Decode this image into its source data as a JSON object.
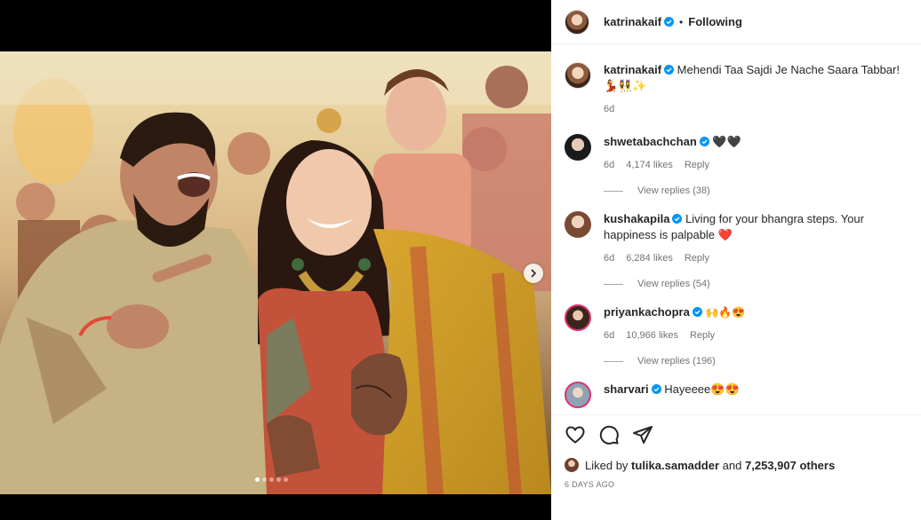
{
  "post": {
    "author": "katrinakaif",
    "follow_status": "Following",
    "separator": "•",
    "caption": "Mehendi Taa Sajdi Je Nache Saara Tabbar! 💃👯‍♀️✨",
    "caption_age": "6d",
    "media": {
      "slide_count": 5,
      "active_slide": 1
    }
  },
  "comments": [
    {
      "username": "shwetabachchan",
      "text": "🖤🖤",
      "age": "6d",
      "likes": "4,174 likes",
      "reply": "Reply",
      "view_replies": "View replies (38)"
    },
    {
      "username": "kushakapila",
      "text": "Living for your bhangra steps. Your happiness is palpable ❤️",
      "age": "6d",
      "likes": "6,284 likes",
      "reply": "Reply",
      "view_replies": "View replies (54)"
    },
    {
      "username": "priyankachopra",
      "text": "🙌🔥😍",
      "age": "6d",
      "likes": "10,966 likes",
      "reply": "Reply",
      "view_replies": "View replies (196)"
    },
    {
      "username": "sharvari",
      "text": "Hayeeee😍😍"
    }
  ],
  "likes": {
    "prefix": "Liked by",
    "user": "tulika.samadder",
    "and": "and",
    "count": "7,253,907 others"
  },
  "date": "6 DAYS AGO",
  "colors": {
    "verified": "#0095f6",
    "secondary_text": "#737373",
    "border": "#efefef"
  },
  "icons": [
    "heart-icon",
    "comment-icon",
    "share-icon",
    "chevron-right-icon",
    "verified-icon"
  ]
}
